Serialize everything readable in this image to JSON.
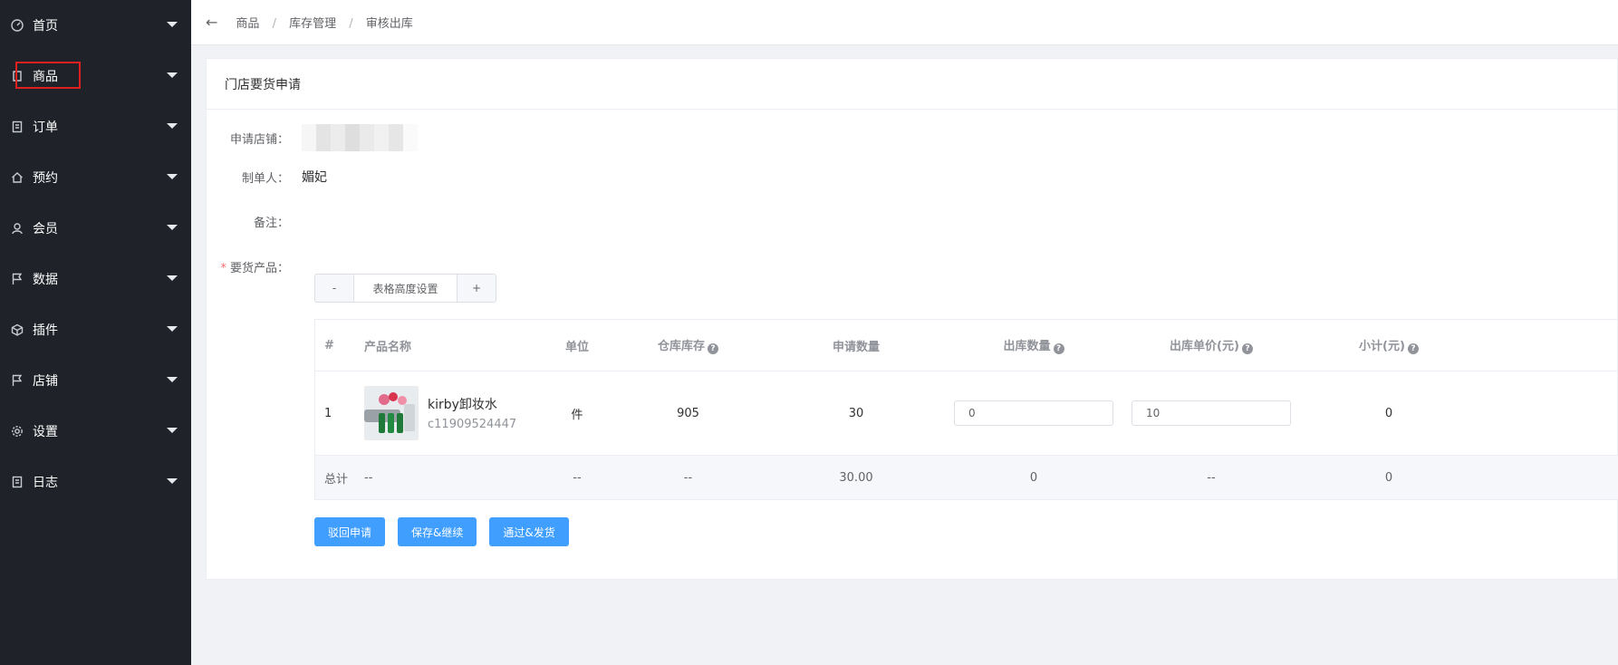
{
  "sidebar": {
    "items": [
      {
        "label": "首页",
        "icon": "dashboard-icon"
      },
      {
        "label": "商品",
        "icon": "goods-icon",
        "active": true
      },
      {
        "label": "订单",
        "icon": "order-icon"
      },
      {
        "label": "预约",
        "icon": "home-icon"
      },
      {
        "label": "会员",
        "icon": "user-icon"
      },
      {
        "label": "数据",
        "icon": "flag-icon"
      },
      {
        "label": "插件",
        "icon": "cube-icon"
      },
      {
        "label": "店铺",
        "icon": "flag-icon"
      },
      {
        "label": "设置",
        "icon": "gear-icon"
      },
      {
        "label": "日志",
        "icon": "log-icon"
      }
    ]
  },
  "header": {
    "back_icon": "←",
    "breadcrumb": [
      "商品",
      "库存管理",
      "审核出库"
    ],
    "separator": "/"
  },
  "card": {
    "title": "门店要货申请",
    "fields": {
      "store_label": "申请店铺：",
      "maker_label": "制单人：",
      "maker_value": "媚妃",
      "remark_label": "备注：",
      "remark_value": "",
      "products_label": "要货产品：",
      "required_mark": "*"
    },
    "height_control": {
      "minus": "-",
      "label": "表格高度设置",
      "plus": "+"
    },
    "table": {
      "headers": {
        "idx": "#",
        "name": "产品名称",
        "unit": "单位",
        "stock": "仓库库存",
        "requested": "申请数量",
        "out_qty": "出库数量",
        "out_price": "出库单价(元)",
        "subtotal": "小计(元)"
      },
      "help_glyph": "?",
      "rows": [
        {
          "idx": "1",
          "name": "kirby卸妆水",
          "code": "c11909524447",
          "unit": "件",
          "stock": "905",
          "requested": "30",
          "out_qty": "0",
          "out_price": "10",
          "subtotal": "0"
        }
      ],
      "total": {
        "label": "总计",
        "name": "--",
        "unit": "--",
        "stock": "--",
        "requested": "30.00",
        "out_qty": "0",
        "out_price": "--",
        "subtotal": "0"
      }
    },
    "buttons": {
      "reject": "驳回申请",
      "save": "保存&继续",
      "approve": "通过&发货"
    }
  },
  "colors": {
    "sidebar_bg": "#1f2329",
    "primary": "#409eff",
    "highlight": "#e02020"
  }
}
